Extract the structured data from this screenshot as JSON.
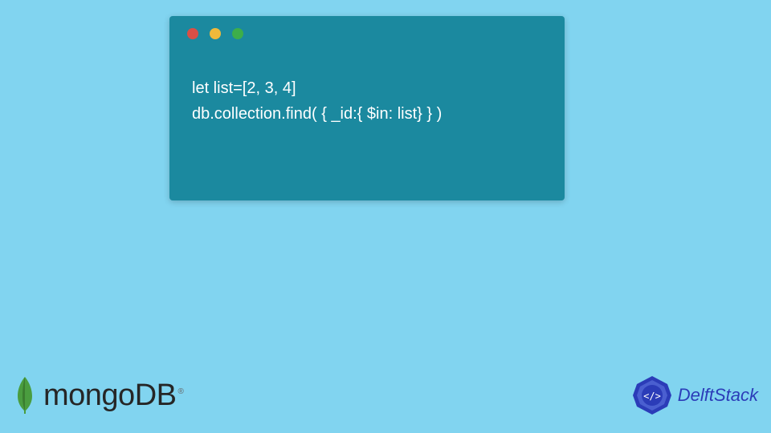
{
  "code": {
    "line1": "let list=[2, 3, 4]",
    "line2": "db.collection.find( { _id:{ $in: list} } )"
  },
  "window": {
    "dots": [
      "red",
      "yellow",
      "green"
    ]
  },
  "footer": {
    "mongo": {
      "text": "mongoDB",
      "tm": "®"
    },
    "delft": {
      "first": "Delft",
      "second": "Stack"
    }
  },
  "colors": {
    "background": "#81d4f0",
    "window": "#1b899f",
    "codeText": "#ffffff",
    "delftBlue": "#2b3cb8",
    "leafGreen": "#4a9d3f"
  }
}
